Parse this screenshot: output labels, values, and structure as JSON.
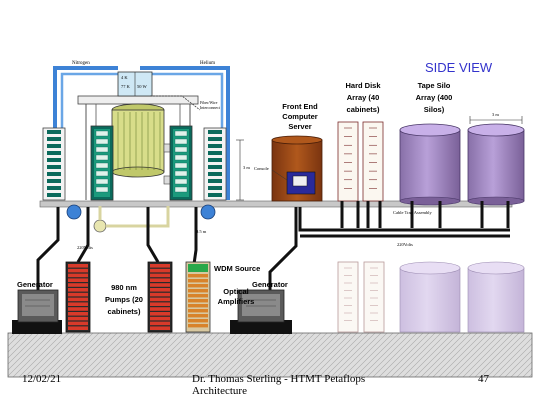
{
  "slide": {
    "title": "SIDE VIEW",
    "title_color": "#3333cc",
    "accent_blue": "#3d82d6",
    "floor_color": "#dcdcdc"
  },
  "labels": {
    "nitrogen": "Nitrogen",
    "helium": "Helium",
    "fiber_wire": "Fiber/Wire Interconnect",
    "he_top": "4 K",
    "he_mid": "50 W",
    "k77": "77 K",
    "dim_3m_left": "3 m",
    "dim_05m": "0.5 m",
    "dim_3m_right": "3 m",
    "console": "Console",
    "cable_tray": "Cable Tray Assembly",
    "power_left": "220Volts",
    "power_right": "220Volts",
    "front_end": "Front End Computer Server",
    "hard_disk": "Hard Disk Array (40 cabinets)",
    "tape_silo": "Tape Silo Array (400 Silos)",
    "generator_left": "Generator",
    "generator_right": "Generator",
    "pumps": "980 nm Pumps (20 cabinets)",
    "wdm_source": "WDM Source",
    "optical_amps": "Optical Amplifiers"
  },
  "footer": {
    "date": "12/02/21",
    "author": "Dr. Thomas Sterling - HTMT Petaflops Architecture",
    "page": "47"
  }
}
